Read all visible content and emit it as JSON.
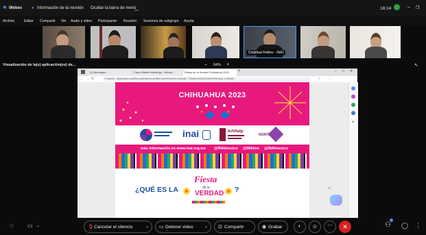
{
  "window": {
    "app_name": "Webex",
    "meeting_info": "Información de la reunión",
    "hide_menu": "Ocultar la barra de menú",
    "clock": "18:14",
    "minimize": "–",
    "restore": "❐"
  },
  "menu": {
    "items": [
      "Archivo",
      "Editar",
      "Compartir",
      "Ver",
      "Audio y video",
      "Participante",
      "Reunión",
      "Sesiones de subgrupo",
      "Ayuda"
    ]
  },
  "participants": {
    "active_speaker": "Cristóbal Robles - INAI"
  },
  "share": {
    "title": "Visualización de la(s) aplicación(es) de...",
    "zoom_minus": "–",
    "zoom_value": "64%",
    "zoom_plus": "+"
  },
  "browser": {
    "tabs": [
      "(2) Mensajes - ...",
      "Cisco Webex Meetings - Deben...",
      "Fiesta de la Verdad Chihuahua 2023"
    ],
    "url": "C:/Users/.../AppData/Local/Microsoft/Windows/INetCache/Content.Outlook/.../Fiesta%20de%20la%20Verdad_Chihuah..."
  },
  "poster": {
    "title": "CHIHUAHUA 2023",
    "logos": [
      "inai",
      "ichitaip",
      "NORTE"
    ],
    "info_line": "más información en www.inai.org.mx",
    "social": [
      "@INAImexico",
      "@INAImx",
      "@INAImexico"
    ],
    "question_prefix": "¿QUÉ ES LA",
    "fiesta_word": "Fiesta",
    "de_la": "de la",
    "verdad_word": "VERDAD",
    "question_suffix": "?"
  },
  "controls": {
    "unmute": "Cancelar el silencio",
    "stop_video": "Detener video",
    "share": "Compartir",
    "record": "Grabar"
  },
  "colors": {
    "poster_pink": "#e8197d",
    "inai_blue": "#1b4fa0",
    "leave_red": "#d42121",
    "webex_blue": "#4f8cf3"
  }
}
